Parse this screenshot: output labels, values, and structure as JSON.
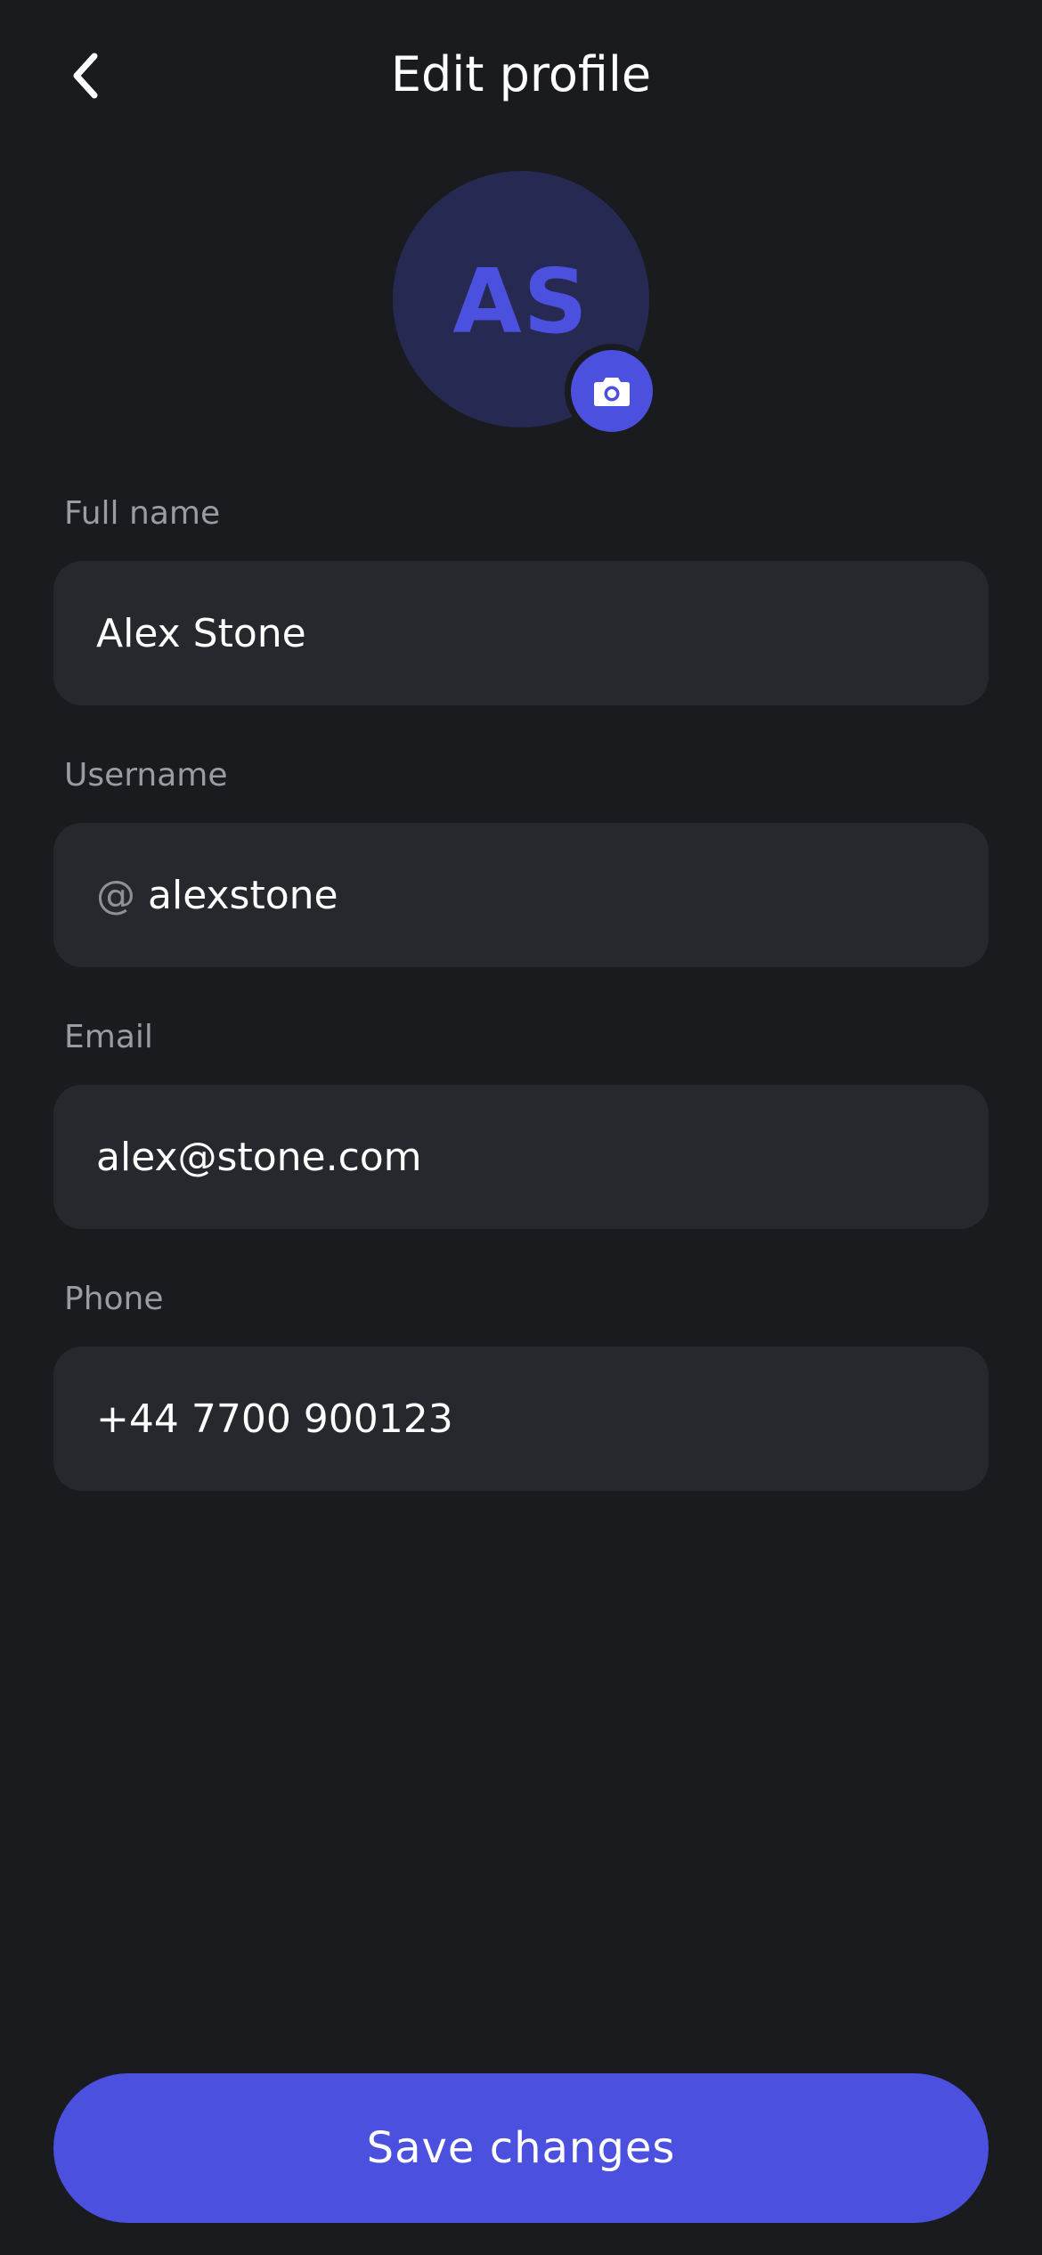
{
  "header": {
    "title": "Edit profile",
    "back_icon": "chevron-left-icon"
  },
  "avatar": {
    "initials": "AS",
    "camera_icon": "camera-icon"
  },
  "form": {
    "full_name": {
      "label": "Full name",
      "value": "Alex Stone"
    },
    "username": {
      "label": "Username",
      "prefix": "@",
      "value": "alexstone"
    },
    "email": {
      "label": "Email",
      "value": "alex@stone.com"
    },
    "phone": {
      "label": "Phone",
      "value": "+44 7700 900123"
    }
  },
  "footer": {
    "save_label": "Save changes"
  },
  "colors": {
    "background": "#191b1f",
    "field_background": "#25282c",
    "accent": "#4b50df",
    "avatar_background": "#262951",
    "label_text": "#9a9ca3"
  }
}
